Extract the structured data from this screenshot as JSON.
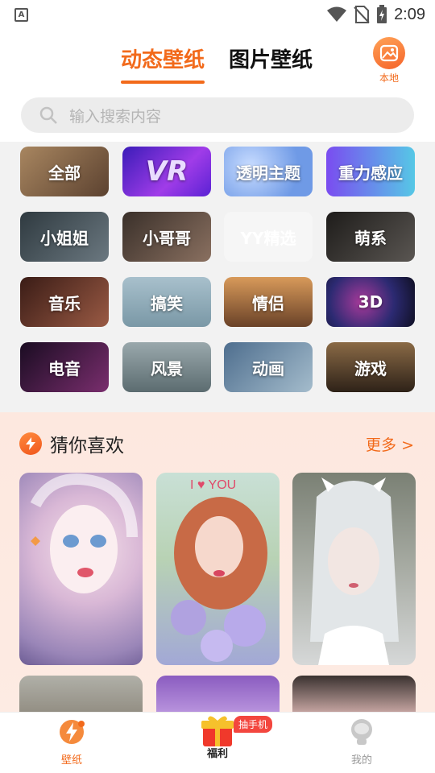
{
  "status_bar": {
    "notification_letter": "A",
    "time": "2:09",
    "icons": [
      "wifi-icon",
      "no-sim-icon",
      "battery-charging-icon"
    ]
  },
  "top_tabs": [
    {
      "label": "动态壁纸",
      "active": true
    },
    {
      "label": "图片壁纸",
      "active": false
    }
  ],
  "local_button": {
    "label": "本地",
    "icon": "gallery-icon"
  },
  "search": {
    "placeholder": "输入搜索内容",
    "icon": "search-icon"
  },
  "categories": [
    {
      "label": "全部",
      "bg": "#8a6a4a"
    },
    {
      "label": "VR",
      "bg": "#6a2fd6"
    },
    {
      "label": "透明主题",
      "bg": "#7da6e8"
    },
    {
      "label": "重力感应",
      "bg": "#8b5cf0"
    },
    {
      "label": "小姐姐",
      "bg": "#4e5a62"
    },
    {
      "label": "小哥哥",
      "bg": "#5a4a40"
    },
    {
      "label": "YY精选",
      "bg": "#f6f6f6"
    },
    {
      "label": "萌系",
      "bg": "#3c3a38"
    },
    {
      "label": "音乐",
      "bg": "#6b3a2e"
    },
    {
      "label": "搞笑",
      "bg": "#8aa6b2"
    },
    {
      "label": "情侣",
      "bg": "#b07a4a"
    },
    {
      "label": "3D",
      "bg": "#2c2a52"
    },
    {
      "label": "电音",
      "bg": "#3a1e3e"
    },
    {
      "label": "风景",
      "bg": "#7c8a8e"
    },
    {
      "label": "动画",
      "bg": "#6f8da6"
    },
    {
      "label": "游戏",
      "bg": "#5c4636"
    }
  ],
  "guess_section": {
    "title": "猜你喜欢",
    "more_label": "更多 >",
    "cards_top": [
      "wallpaper-card-1",
      "wallpaper-card-2",
      "wallpaper-card-3"
    ],
    "overlay_text": "I ♥ YOU"
  },
  "bottom_nav": [
    {
      "label": "壁纸",
      "icon": "wallpaper-bolt-icon",
      "active": true
    },
    {
      "label": "福利",
      "icon": "gift-box-icon",
      "active": false,
      "badge": "抽手机"
    },
    {
      "label": "我的",
      "icon": "profile-icon",
      "active": false
    }
  ],
  "colors": {
    "accent": "#f26a1b",
    "search_bg": "#ececec",
    "section_bg": "#fde8df",
    "grid_bg": "#f2f2f2"
  }
}
